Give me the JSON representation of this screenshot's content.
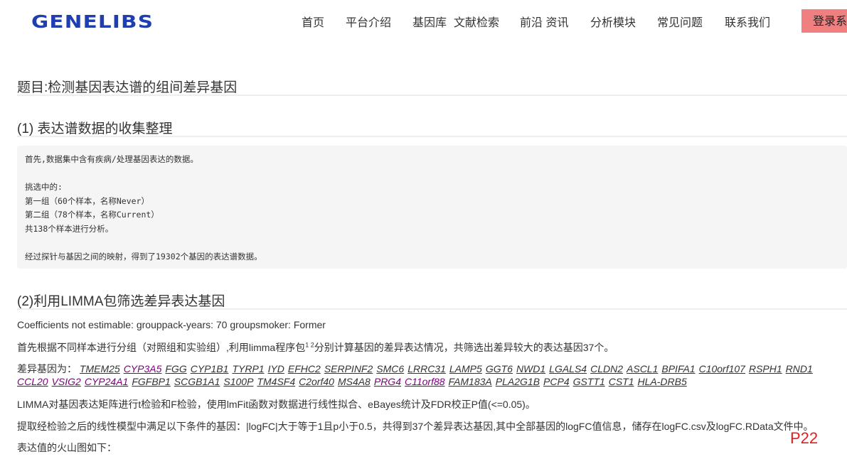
{
  "header": {
    "logo": "GENELIBS",
    "nav": [
      {
        "label": "首页"
      },
      {
        "label": "平台介绍"
      },
      {
        "label": "基因库"
      },
      {
        "label": "文献检索"
      },
      {
        "label": "前沿 资讯"
      },
      {
        "label": "分析模块"
      },
      {
        "label": "常见问题"
      },
      {
        "label": "联系我们"
      }
    ],
    "login": "登录系"
  },
  "article": {
    "title": "题目:检测基因表达谱的组间差异基因",
    "section1": {
      "heading": "(1) 表达谱数据的收集整理",
      "code_lines": [
        "首先,数据集中含有疾病/处理基因表达的数据。",
        "挑选中的:",
        "第一组（60个样本，名称Never）",
        "第二组（78个样本，名称Current）",
        "共138个样本进行分析。",
        "经过探针与基因之间的映射，得到了19302个基因的表达谱数据。"
      ]
    },
    "section2": {
      "heading": "(2)利用LIMMA包筛选差异表达基因",
      "coef_note": "Coefficients not estimable: grouppack-years: 70 groupsmoker: Former",
      "para1_before": "首先根据不同样本进行分组（对照组和实验组）,利用limma程序包",
      "para1_sup": "1 2",
      "para1_after": "分别计算基因的差异表达情况，共筛选出差异较大的表达基因37个。",
      "genes_label": "差异基因为：",
      "genes_row1": [
        {
          "name": "TMEM25",
          "visited": false
        },
        {
          "name": "CYP3A5",
          "visited": true
        },
        {
          "name": "FGG",
          "visited": false
        },
        {
          "name": "CYP1B1",
          "visited": false
        },
        {
          "name": "TYRP1",
          "visited": false
        },
        {
          "name": "IYD",
          "visited": false
        },
        {
          "name": "EFHC2",
          "visited": false
        },
        {
          "name": "SERPINF2",
          "visited": false
        },
        {
          "name": "SMC6",
          "visited": false
        },
        {
          "name": "LRRC31",
          "visited": false
        },
        {
          "name": "LAMP5",
          "visited": false
        },
        {
          "name": "GGT6",
          "visited": false
        },
        {
          "name": "NWD1",
          "visited": false
        },
        {
          "name": "LGALS4",
          "visited": false
        },
        {
          "name": "CLDN2",
          "visited": false
        },
        {
          "name": "ASCL1",
          "visited": false
        },
        {
          "name": "BPIFA1",
          "visited": false
        },
        {
          "name": "C10orf107",
          "visited": false
        },
        {
          "name": "RSPH1",
          "visited": false
        },
        {
          "name": "RND1",
          "visited": false
        }
      ],
      "genes_row2": [
        {
          "name": "CCL20",
          "visited": true
        },
        {
          "name": "VSIG2",
          "visited": true
        },
        {
          "name": "CYP24A1",
          "visited": true
        },
        {
          "name": "FGFBP1",
          "visited": false
        },
        {
          "name": "SCGB1A1",
          "visited": false
        },
        {
          "name": "S100P",
          "visited": false
        },
        {
          "name": "TM4SF4",
          "visited": false
        },
        {
          "name": "C2orf40",
          "visited": false
        },
        {
          "name": "MS4A8",
          "visited": false
        },
        {
          "name": "PRG4",
          "visited": true
        },
        {
          "name": "C11orf88",
          "visited": true
        },
        {
          "name": "FAM183A",
          "visited": false
        },
        {
          "name": "PLA2G1B",
          "visited": false
        },
        {
          "name": "PCP4",
          "visited": false
        },
        {
          "name": "GSTT1",
          "visited": false
        },
        {
          "name": "CST1",
          "visited": false
        },
        {
          "name": "HLA-DRB5",
          "visited": false
        }
      ],
      "para2": "LIMMA对基因表达矩阵进行t检验和F检验，使用lmFit函数对数据进行线性拟合、eBayes统计及FDR校正P值(<=0.05)。",
      "para3": "提取经检验之后的线性模型中满足以下条件的基因：|logFC|大于等于1且p小于0.5，共得到37个差异表达基因,其中全部基因的logFC值信息，储存在logFC.csv及logFC.RData文件中。",
      "para4": "表达值的火山图如下："
    }
  },
  "page_marker": "P22"
}
